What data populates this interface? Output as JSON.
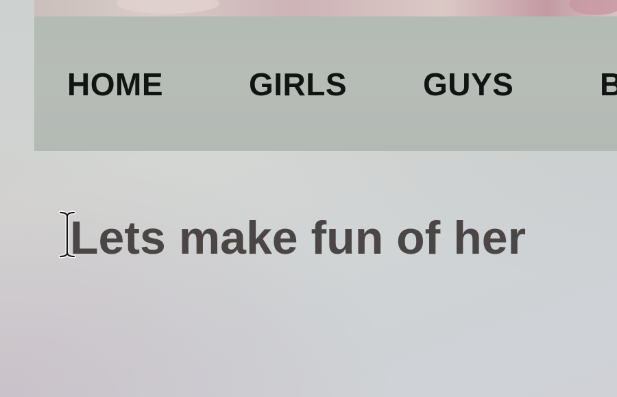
{
  "nav": {
    "items": [
      {
        "label": "HOME"
      },
      {
        "label": "GIRLS"
      },
      {
        "label": "GUYS"
      },
      {
        "label": "B"
      }
    ]
  },
  "main": {
    "headline": "Lets make fun of her"
  },
  "colors": {
    "nav_bg": "#b5bbb5",
    "nav_text": "#111412",
    "page_bg": "#d0d3d1",
    "headline_text": "#4a4645"
  },
  "icons": {
    "cursor": "text-cursor-icon"
  }
}
